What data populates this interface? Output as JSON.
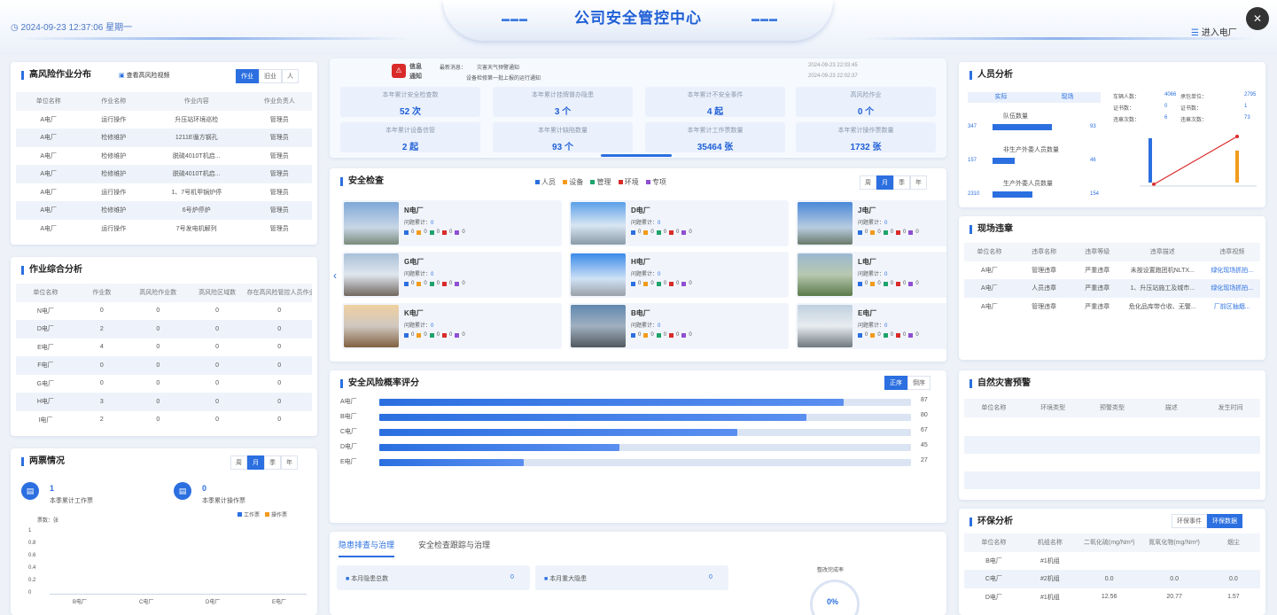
{
  "header": {
    "title": "公司安全管控中心",
    "datetime": "2024-09-23 12:37:06 星期一",
    "enter_label": "进入电厂",
    "close_label": "✕"
  },
  "high_risk": {
    "title": "高风险作业分布",
    "video_link": "查看高风险视频",
    "tabs": [
      "作业",
      "旧业",
      "人"
    ],
    "columns": [
      "单位名称",
      "作业名称",
      "作业内容",
      "作业负责人"
    ],
    "rows": [
      [
        "A电厂",
        "运行操作",
        "升压站环境巡检",
        "管理员"
      ],
      [
        "A电厂",
        "检修维护",
        "1211E循方钢孔",
        "管理员"
      ],
      [
        "A电厂",
        "检修维护",
        "脱硫4010T机启...",
        "管理员"
      ],
      [
        "A电厂",
        "检修维护",
        "脱硫4010T机启...",
        "管理员"
      ],
      [
        "A电厂",
        "运行操作",
        "1、7号机甲锅炉停",
        "管理员"
      ],
      [
        "A电厂",
        "检修维护",
        "6号炉停炉",
        "管理员"
      ],
      [
        "A电厂",
        "运行操作",
        "7号发电机解列",
        "管理员"
      ]
    ]
  },
  "work_analysis": {
    "title": "作业综合分析",
    "columns": [
      "单位名称",
      "作业数",
      "高风险作业数",
      "高风险区域数",
      "存在高风险管控人员作业数"
    ],
    "rows": [
      [
        "N电厂",
        "0",
        "0",
        "0",
        "0"
      ],
      [
        "D电厂",
        "2",
        "0",
        "0",
        "0"
      ],
      [
        "E电厂",
        "4",
        "0",
        "0",
        "0"
      ],
      [
        "F电厂",
        "0",
        "0",
        "0",
        "0"
      ],
      [
        "G电厂",
        "0",
        "0",
        "0",
        "0"
      ],
      [
        "H电厂",
        "3",
        "0",
        "0",
        "0"
      ],
      [
        "I电厂",
        "2",
        "0",
        "0",
        "0"
      ]
    ]
  },
  "ticket": {
    "title": "两票情况",
    "tabs": [
      "周",
      "月",
      "季",
      "年"
    ],
    "work_value": "1",
    "work_label": "本季累计工作票",
    "op_value": "0",
    "op_label": "本季累计操作票",
    "legend": [
      "工作票",
      "操作票"
    ],
    "unit": "票数：张",
    "y_ticks": [
      "1",
      "0.8",
      "0.6",
      "0.4",
      "0.2",
      "0"
    ],
    "x_ticks": [
      "B电厂",
      "C电厂",
      "D电厂",
      "E电厂"
    ]
  },
  "notice": {
    "label_a": "信息",
    "label_b": "通知",
    "latest_label": "最新消息：",
    "msg1": "灾害天气预警通知",
    "msg2": "设备检修第一批上报的运行通知",
    "time1": "2024-09-23 22:03:45",
    "time2": "2024-09-23 22:02:37"
  },
  "stats": [
    {
      "label": "本年累计安全检查数",
      "value": "52 次"
    },
    {
      "label": "本年累计挂牌督办隐患",
      "value": "3 个"
    },
    {
      "label": "本年累计不安全事件",
      "value": "4 起"
    },
    {
      "label": "高风险作业",
      "value": "0 个"
    },
    {
      "label": "本年累计设备信管",
      "value": "2 起"
    },
    {
      "label": "本年累计缺陷数量",
      "value": "93 个"
    },
    {
      "label": "本年累计工作票数量",
      "value": "35464 张"
    },
    {
      "label": "本年累计操作票数量",
      "value": "1732 张"
    }
  ],
  "inspection": {
    "title": "安全检查",
    "legend": [
      "人员",
      "设备",
      "管理",
      "环境",
      "专项"
    ],
    "tabs": [
      "周",
      "月",
      "季",
      "年"
    ],
    "issue_label": "问题累计：",
    "prev": "‹",
    "next": "›",
    "plants": [
      {
        "name": "N电厂",
        "count": "0"
      },
      {
        "name": "D电厂",
        "count": "0"
      },
      {
        "name": "J电厂",
        "count": "0"
      },
      {
        "name": "G电厂",
        "count": "0"
      },
      {
        "name": "H电厂",
        "count": "0"
      },
      {
        "name": "L电厂",
        "count": "0"
      },
      {
        "name": "K电厂",
        "count": "0"
      },
      {
        "name": "B电厂",
        "count": "0"
      },
      {
        "name": "E电厂",
        "count": "0"
      }
    ]
  },
  "risk_score": {
    "title": "安全风险概率评分",
    "tabs": [
      "正序",
      "倒序"
    ],
    "items": [
      {
        "name": "A电厂",
        "value": 87
      },
      {
        "name": "B电厂",
        "value": 80
      },
      {
        "name": "C电厂",
        "value": 67
      },
      {
        "name": "D电厂",
        "value": 45
      },
      {
        "name": "E电厂",
        "value": 27
      }
    ]
  },
  "hazard": {
    "tabs": [
      "隐患排查与治理",
      "安全检查跟踪与治理"
    ],
    "row1": [
      "本月隐患总数",
      "0",
      "本月重大隐患",
      "0"
    ],
    "rate_label": "整改完成率",
    "rate_value": "0%"
  },
  "personnel": {
    "title": "人员分析",
    "tabs": [
      "实际",
      "现场"
    ],
    "bars": [
      {
        "label": "队伍数量",
        "left": "347",
        "right": "93"
      },
      {
        "label": "非生产外委人员数量",
        "left": "157",
        "right": "46"
      },
      {
        "label": "生产外委人员数量",
        "left": "2310",
        "right": "154"
      }
    ],
    "kv": [
      [
        "车辆人数：",
        "4066",
        "承包单位：",
        "2795"
      ],
      [
        "证书数：",
        "0",
        "证书数：",
        "1"
      ],
      [
        "违章次数：",
        "6",
        "违章次数：",
        "73"
      ]
    ]
  },
  "violation": {
    "title": "现场违章",
    "columns": [
      "单位名称",
      "违章名称",
      "违章等级",
      "违章描述",
      "违章视频"
    ],
    "rows": [
      [
        "A电厂",
        "管理违章",
        "严重违章",
        "未按设置跑团机NLTX...",
        "绿化现场抓拍..."
      ],
      [
        "A电厂",
        "人员违章",
        "严重违章",
        "1、升压站施工及城市...",
        "绿化现场抓拍..."
      ],
      [
        "A电厂",
        "管理违章",
        "严重违章",
        "危化品库带仓收、无警...",
        "厂前区抽烟..."
      ]
    ]
  },
  "disaster": {
    "title": "自然灾害预警",
    "columns": [
      "单位名称",
      "环境类型",
      "预警类型",
      "描述",
      "发生时间"
    ]
  },
  "env": {
    "title": "环保分析",
    "tabs": [
      "环保事件",
      "环保数据"
    ],
    "columns": [
      "单位名称",
      "机组名称",
      "二氧化硫(mg/Nm³)",
      "氮氧化物(mg/Nm³)",
      "烟尘"
    ],
    "rows": [
      [
        "B电厂",
        "#1机组",
        "",
        "",
        ""
      ],
      [
        "C电厂",
        "#2机组",
        "0.0",
        "0.0",
        "0.0"
      ],
      [
        "D电厂",
        "#1机组",
        "12.56",
        "20.77",
        "1.57"
      ]
    ]
  },
  "colors": {
    "accent": "#2b6fe0",
    "person": "#2b6fe0",
    "device": "#f29b1c",
    "mgmt": "#1ea36a",
    "env": "#d92a2a",
    "special": "#8f4fd1"
  }
}
